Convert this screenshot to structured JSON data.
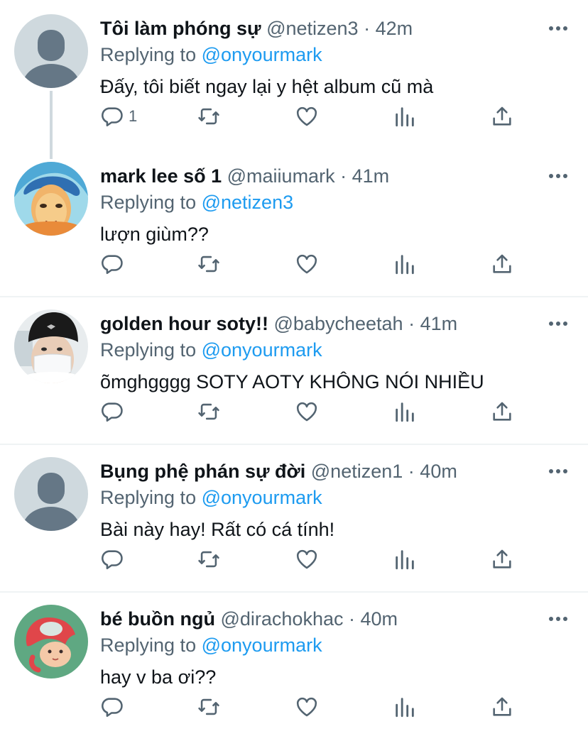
{
  "tweets": [
    {
      "name": "Tôi làm phóng sự",
      "handle": "@netizen3",
      "time": "42m",
      "replying_label": "Replying to",
      "replying_to": "@onyourmark",
      "text": "Đấy, tôi biết ngay lại y hệt album cũ mà",
      "reply_count": "1",
      "avatar": "default-avatar"
    },
    {
      "name": "mark lee số 1",
      "handle": "@maiiumark",
      "time": "41m",
      "replying_label": "Replying to",
      "replying_to": "@netizen3",
      "text": "lượn giùm??",
      "reply_count": "",
      "avatar": "photo-avatar-blue-hair"
    },
    {
      "name": "golden hour soty!!",
      "handle": "@babycheetah",
      "time": "41m",
      "replying_label": "Replying to",
      "replying_to": "@onyourmark",
      "text": "õmghgggg SOTY AOTY KHÔNG NÓI NHIỀU",
      "reply_count": "",
      "avatar": "photo-avatar-beanie-mask"
    },
    {
      "name": "Bụng phệ phán sự đời",
      "handle": "@netizen1",
      "time": "40m",
      "replying_label": "Replying to",
      "replying_to": "@onyourmark",
      "text": "Bài này hay! Rất có cá tính!",
      "reply_count": "",
      "avatar": "default-avatar"
    },
    {
      "name": "bé buồn ngủ",
      "handle": "@dirachokhac",
      "time": "40m",
      "replying_label": "Replying to",
      "replying_to": "@onyourmark",
      "text": "hay v ba ơi??",
      "reply_count": "",
      "avatar": "cartoon-avatar-ponyo"
    }
  ],
  "separator": "·",
  "icons": {
    "more": "more-dots-icon",
    "reply": "reply-icon",
    "retweet": "retweet-icon",
    "like": "heart-icon",
    "views": "analytics-icon",
    "share": "share-icon"
  },
  "colors": {
    "text": "#0f1419",
    "secondary": "#536471",
    "link": "#1d9bf0",
    "divider": "#eff3f4",
    "thread_line": "#cfd9de"
  }
}
